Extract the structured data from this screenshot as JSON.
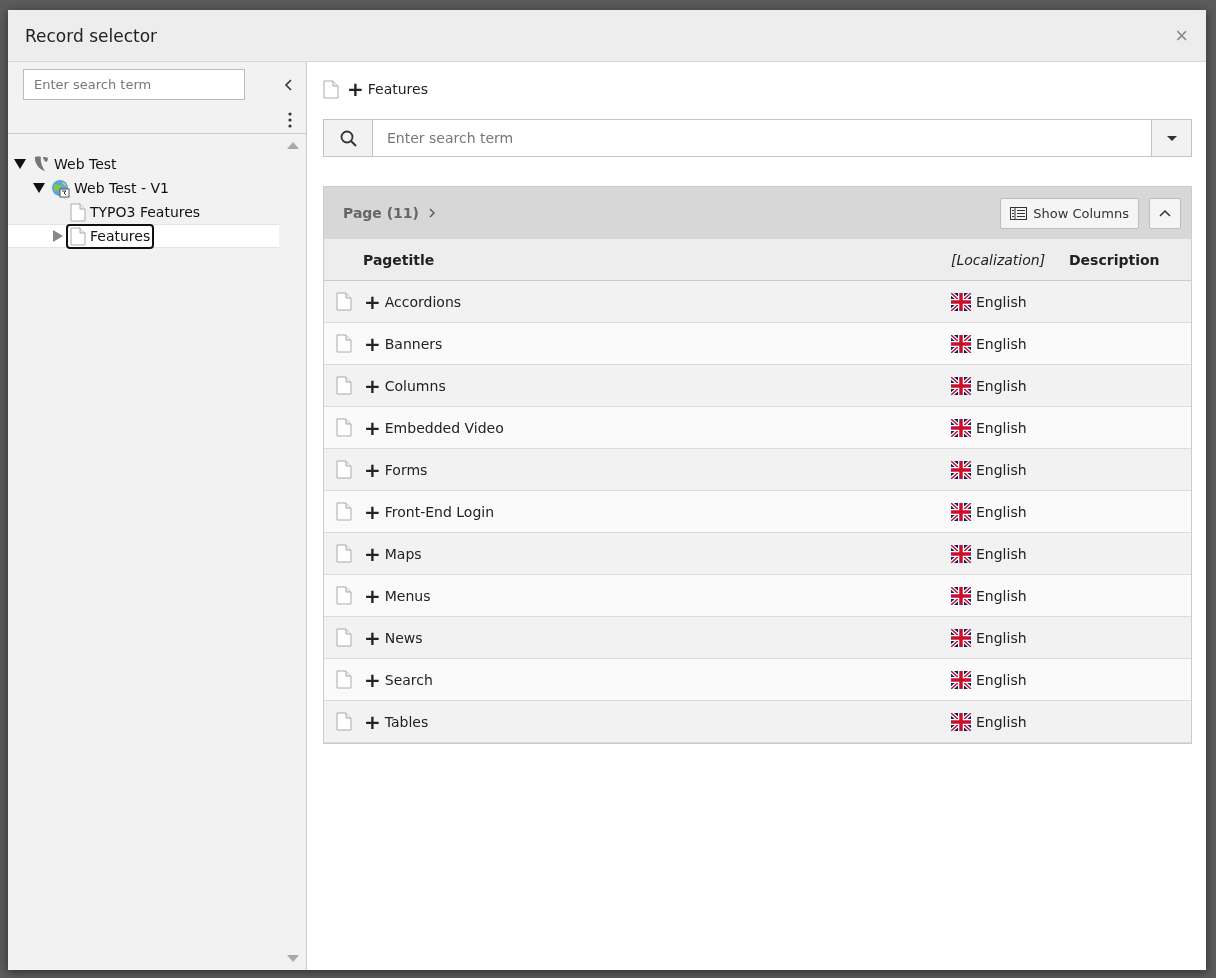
{
  "window": {
    "title": "Record selector",
    "close": "×"
  },
  "sidebar": {
    "search": {
      "placeholder": "Enter search term"
    },
    "tree": [
      {
        "label": "Web Test",
        "kind": "root",
        "expanded": true,
        "selected": false,
        "children": [
          {
            "label": "Web Test - V1",
            "kind": "site",
            "expanded": true,
            "selected": false,
            "children": [
              {
                "label": "TYPO3 Features",
                "kind": "page",
                "selected": false
              },
              {
                "label": "Features",
                "kind": "page",
                "expanded": false,
                "selected": true
              }
            ]
          }
        ]
      }
    ]
  },
  "breadcrumb": {
    "plus": "+",
    "label": "Features"
  },
  "search": {
    "placeholder": "Enter search term"
  },
  "table": {
    "title": "Page (11)",
    "show_columns": "Show Columns",
    "columns": [
      "Pagetitle",
      "[Localization]",
      "Description"
    ],
    "rows": [
      {
        "plus": "+",
        "title": "Accordions",
        "language": "English"
      },
      {
        "plus": "+",
        "title": "Banners",
        "language": "English"
      },
      {
        "plus": "+",
        "title": "Columns",
        "language": "English"
      },
      {
        "plus": "+",
        "title": "Embedded Video",
        "language": "English"
      },
      {
        "plus": "+",
        "title": "Forms",
        "language": "English"
      },
      {
        "plus": "+",
        "title": "Front-End Login",
        "language": "English"
      },
      {
        "plus": "+",
        "title": "Maps",
        "language": "English"
      },
      {
        "plus": "+",
        "title": "Menus",
        "language": "English"
      },
      {
        "plus": "+",
        "title": "News",
        "language": "English"
      },
      {
        "plus": "+",
        "title": "Search",
        "language": "English"
      },
      {
        "plus": "+",
        "title": "Tables",
        "language": "English"
      }
    ]
  }
}
